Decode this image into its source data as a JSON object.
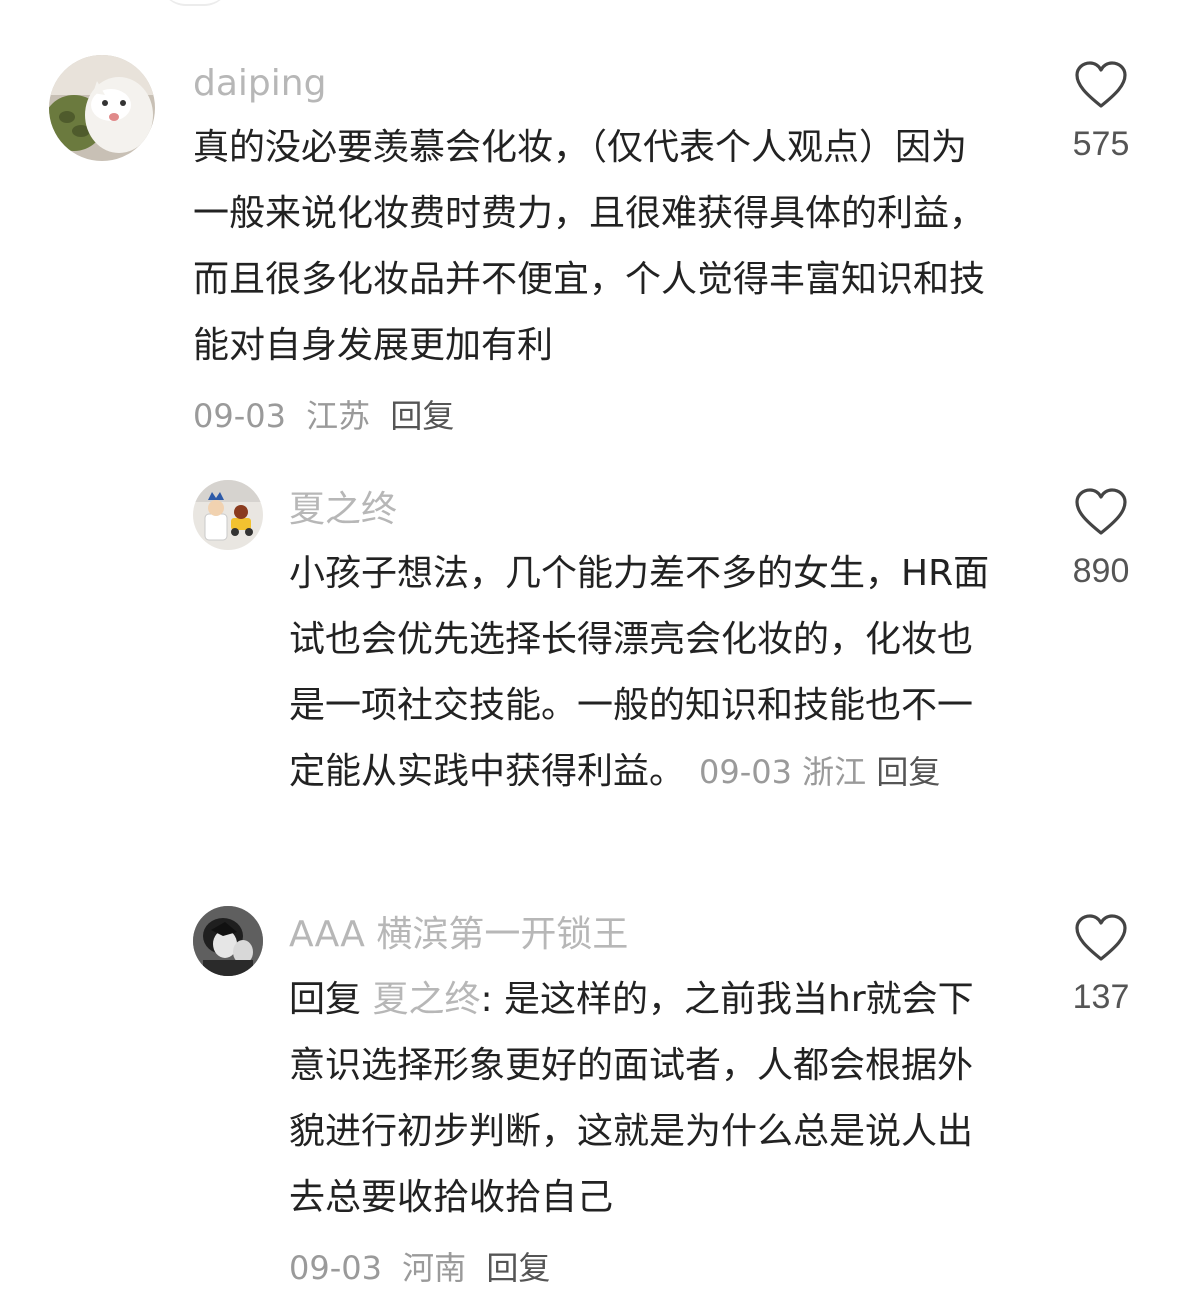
{
  "comments": [
    {
      "username": "daiping",
      "avatar": "cat-avatar",
      "text": "真的没必要羡慕会化妆，（仅代表个人观点）因为一般来说化妆费时费力，且很难获得具体的利益，而且很多化妆品并不便宜，个人觉得丰富知识和技能对自身发展更加有利",
      "date": "09-03",
      "location": "江苏",
      "reply_label": "回复",
      "likes": "575"
    },
    {
      "username": "夏之终",
      "avatar": "toy-avatar",
      "text": "小孩子想法，几个能力差不多的女生，HR面试也会优先选择长得漂亮会化妆的，化妆也是一项社交技能。一般的知识和技能也不一定能从实践中获得利益。",
      "date": "09-03",
      "location": "浙江",
      "reply_label": "回复",
      "likes": "890"
    },
    {
      "username": "AAA 横滨第一开锁王",
      "avatar": "anime-avatar",
      "reply_prefix": "回复",
      "reply_to": "夏之终",
      "text": ": 是这样的，之前我当hr就会下意识选择形象更好的面试者，人都会根据外貌进行初步判断，这就是为什么总是说人出去总要收拾收拾自己",
      "date": "09-03",
      "location": "河南",
      "reply_label": "回复",
      "likes": "137"
    }
  ],
  "icons": {
    "like": "heart-outline-icon"
  },
  "colors": {
    "username": "#b7b7b7",
    "meta": "#9a9a9a",
    "text": "#222222",
    "like_count": "#555555"
  }
}
